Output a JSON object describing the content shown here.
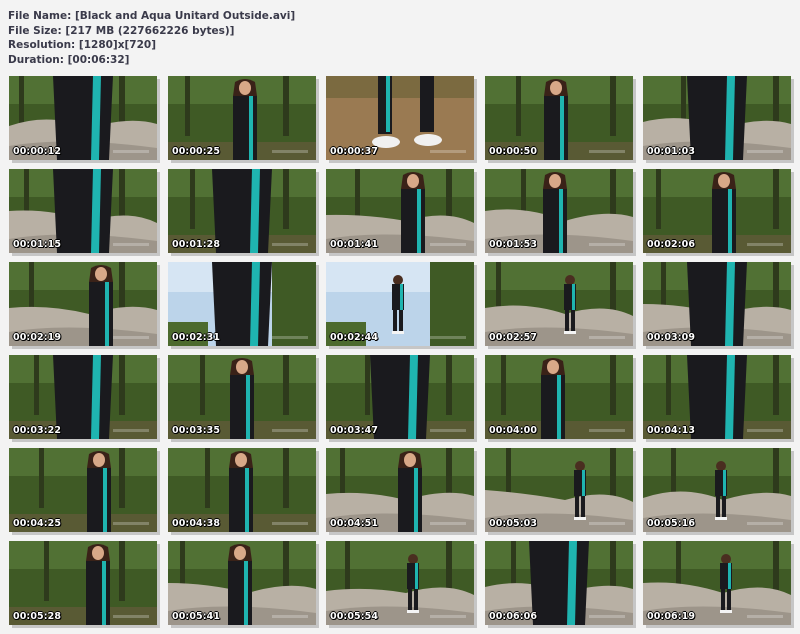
{
  "header": {
    "file_name": "File Name: [Black and Aqua Unitard Outside.avi]",
    "file_size": "File Size: [217 MB (227662226 bytes)]",
    "resolution": "Resolution: [1280]x[720]",
    "duration": "Duration: [00:06:32]"
  },
  "thumbnails": [
    {
      "time": "00:00:12",
      "scene": "rocks-closeup"
    },
    {
      "time": "00:00:25",
      "scene": "standing-forest"
    },
    {
      "time": "00:00:37",
      "scene": "shoes-dirt"
    },
    {
      "time": "00:00:50",
      "scene": "back-forest"
    },
    {
      "time": "00:01:03",
      "scene": "rocks-closeup"
    },
    {
      "time": "00:01:15",
      "scene": "rocks-closeup"
    },
    {
      "time": "00:01:28",
      "scene": "back-closeup"
    },
    {
      "time": "00:01:41",
      "scene": "forest-rocks"
    },
    {
      "time": "00:01:53",
      "scene": "forest-rocks"
    },
    {
      "time": "00:02:06",
      "scene": "side-forest"
    },
    {
      "time": "00:02:19",
      "scene": "forest-rocks"
    },
    {
      "time": "00:02:31",
      "scene": "sky-closeup"
    },
    {
      "time": "00:02:44",
      "scene": "sky-portrait"
    },
    {
      "time": "00:02:57",
      "scene": "field-far"
    },
    {
      "time": "00:03:09",
      "scene": "rocks-closeup"
    },
    {
      "time": "00:03:22",
      "scene": "forest-closeup"
    },
    {
      "time": "00:03:35",
      "scene": "back-forest"
    },
    {
      "time": "00:03:47",
      "scene": "forest-closeup"
    },
    {
      "time": "00:04:00",
      "scene": "side-forest"
    },
    {
      "time": "00:04:13",
      "scene": "forest-closeup"
    },
    {
      "time": "00:04:25",
      "scene": "standing-forest"
    },
    {
      "time": "00:04:38",
      "scene": "standing-forest"
    },
    {
      "time": "00:04:51",
      "scene": "forest-rocks"
    },
    {
      "time": "00:05:03",
      "scene": "field-far"
    },
    {
      "time": "00:05:16",
      "scene": "field-far"
    },
    {
      "time": "00:05:28",
      "scene": "standing-forest"
    },
    {
      "time": "00:05:41",
      "scene": "forest-rocks"
    },
    {
      "time": "00:05:54",
      "scene": "field-far"
    },
    {
      "time": "00:06:06",
      "scene": "rocks-closeup"
    },
    {
      "time": "00:06:19",
      "scene": "field-far"
    }
  ],
  "colors": {
    "background": "#f3f3f3",
    "header_text": "#3a3a4a",
    "foliage": "#3f5a25",
    "rocks": "#b8b0a4",
    "unitard": "#1a1a1e",
    "aqua_stripe": "#1fb4b0",
    "sky": "#bcd4ea"
  }
}
